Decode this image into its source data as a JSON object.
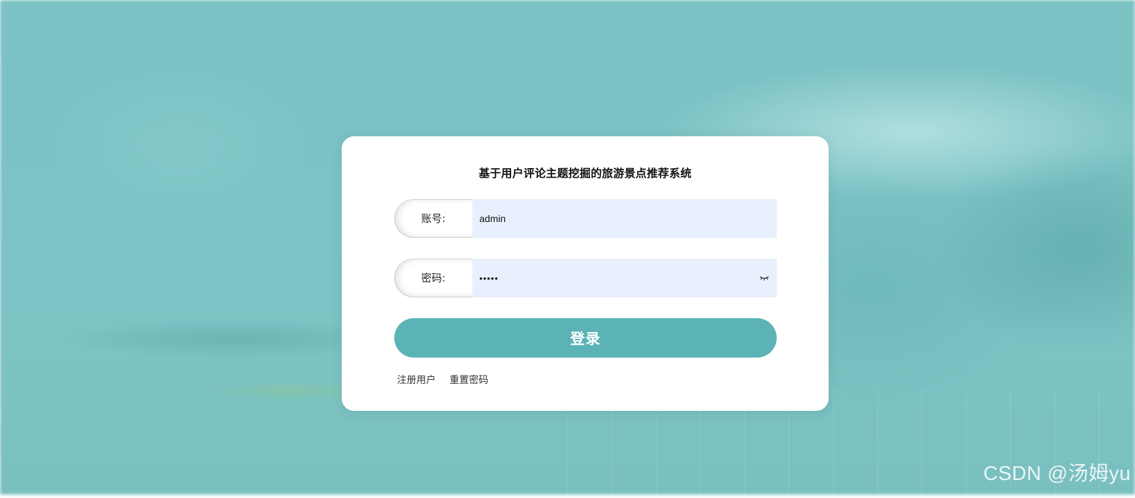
{
  "app": {
    "title": "基于用户评论主题挖掘的旅游景点推荐系统"
  },
  "form": {
    "account": {
      "label": "账号:",
      "value": "admin"
    },
    "password": {
      "label": "密码:",
      "value": "•••••",
      "eye_icon": "eye-closed-icon"
    },
    "login_label": "登录",
    "links": [
      {
        "label": "注册用户"
      },
      {
        "label": "重置密码"
      }
    ]
  },
  "watermark": "CSDN @汤姆yu",
  "colors": {
    "background": "#7cc2c4",
    "card": "#ffffff",
    "button": "#5cb3b6",
    "input_fill": "#e8f0fd"
  }
}
